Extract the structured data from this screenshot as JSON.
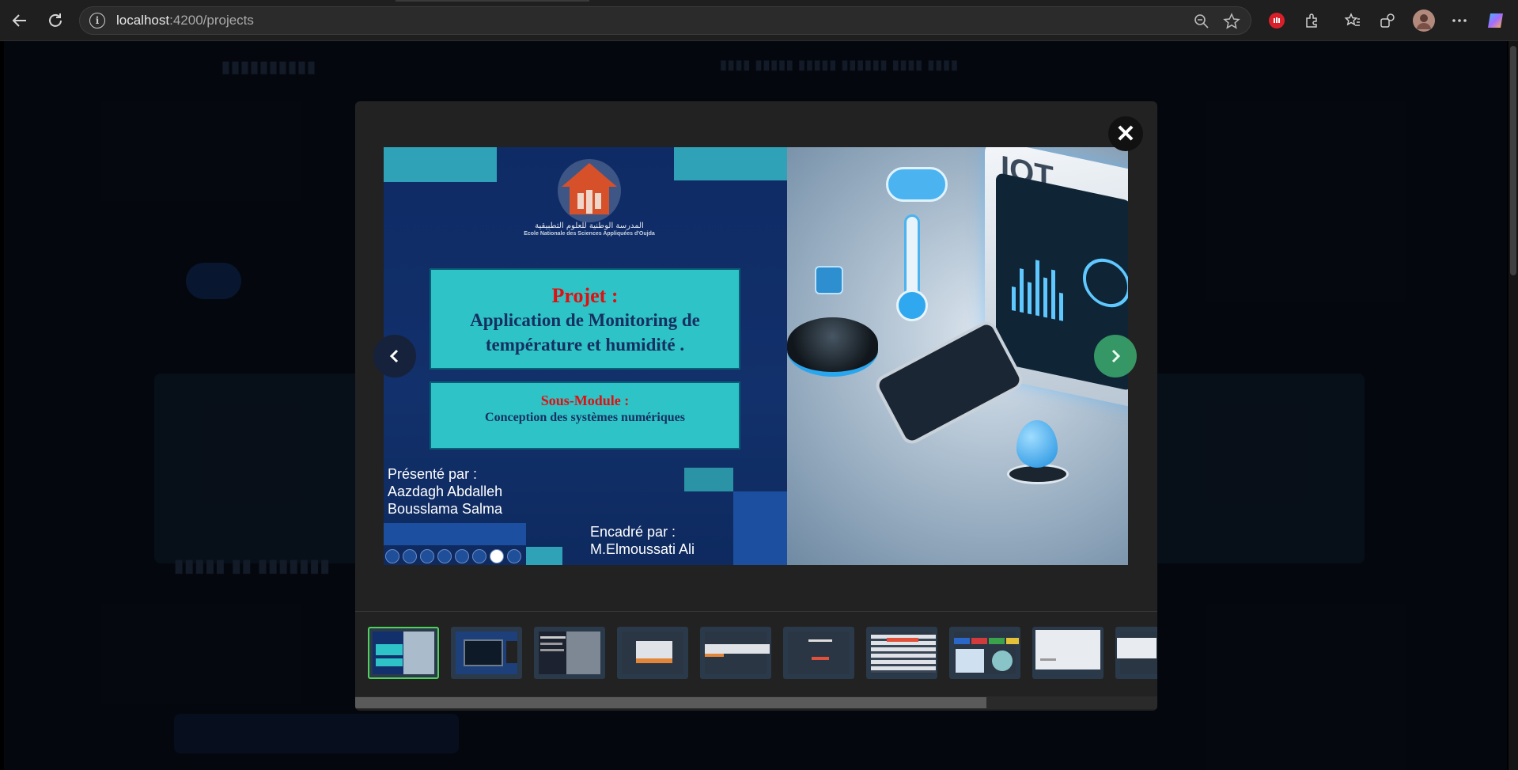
{
  "browser": {
    "url_host": "localhost",
    "url_path": ":4200/projects"
  },
  "slide": {
    "logo_arabic": "المدرسة الوطنية للعلوم التطبيقية",
    "logo_school": "Ecole Nationale des Sciences Appliquées d'Oujda",
    "title_label": "Projet :",
    "title_line1": "Application de Monitoring de",
    "title_line2": "température et humidité .",
    "submodule_label": "Sous-Module :",
    "submodule_text": "Conception des systèmes numériques",
    "presented_label": "Présenté par :",
    "presenter1": "Aazdagh Abdalleh",
    "presenter2": "Bousslama Salma",
    "supervisor_label": "Encadré par :",
    "supervisor": "M.Elmoussati Ali",
    "iot_text": "IOT"
  },
  "modal": {
    "close_symbol": "✕"
  },
  "thumbnails": [
    {
      "kind": "cover",
      "active": true
    },
    {
      "kind": "laptop"
    },
    {
      "kind": "doc"
    },
    {
      "kind": "screen-orange"
    },
    {
      "kind": "screen-bar"
    },
    {
      "kind": "screen-form"
    },
    {
      "kind": "screen-table"
    },
    {
      "kind": "screen-colors"
    },
    {
      "kind": "screen-white"
    },
    {
      "kind": "screen-partial"
    }
  ],
  "colors": {
    "active_thumb_border": "#4fd25a",
    "slide_box": "#2ec3c7",
    "slide_title_red": "#e01010"
  }
}
